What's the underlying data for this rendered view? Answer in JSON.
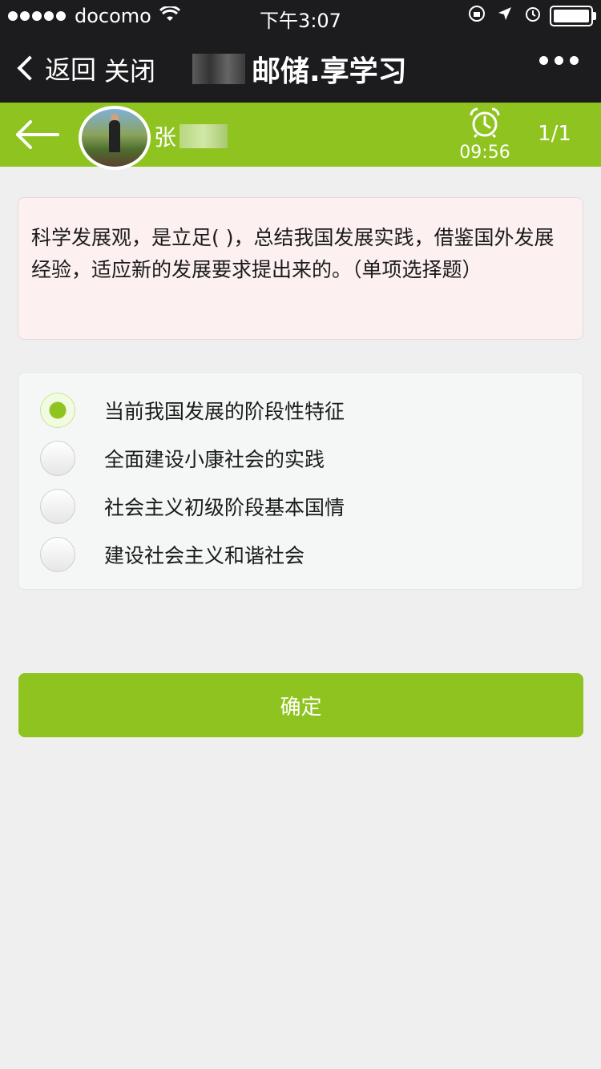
{
  "status_bar": {
    "carrier": "docomo",
    "time": "下午3:07"
  },
  "nav": {
    "back_label": "返回",
    "close_label": "关闭",
    "title": "邮储.享学习"
  },
  "header": {
    "user_name": "张",
    "timer": "09:56",
    "page_count": "1/1",
    "accent_color": "#8fc31f"
  },
  "question": {
    "text": "科学发展观，是立足( )，总结我国发展实践，借鉴国外发展经验，适应新的发展要求提出来的。（单项选择题）"
  },
  "options": [
    {
      "label": "当前我国发展的阶段性特征",
      "selected": true
    },
    {
      "label": "全面建设小康社会的实践",
      "selected": false
    },
    {
      "label": "社会主义初级阶段基本国情",
      "selected": false
    },
    {
      "label": "建设社会主义和谐社会",
      "selected": false
    }
  ],
  "confirm_label": "确定"
}
